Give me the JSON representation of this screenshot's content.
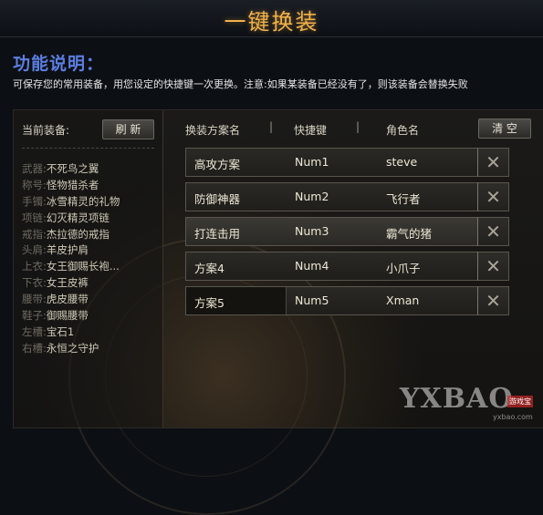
{
  "title": "一键换装",
  "description": {
    "heading": "功能说明：",
    "text": "可保存您的常用装备，用您设定的快捷键一次更换。注意:如果某装备已经没有了，则该装备会替换失败"
  },
  "current_equipment": {
    "label": "当前装备:",
    "refresh_label": "刷 新",
    "items": [
      {
        "slot": "武器:",
        "name": "不死鸟之翼"
      },
      {
        "slot": "称号:",
        "name": "怪物猎杀者"
      },
      {
        "slot": "手镯:",
        "name": "冰雪精灵的礼物"
      },
      {
        "slot": "项链:",
        "name": "幻灭精灵项链"
      },
      {
        "slot": "戒指:",
        "name": "杰拉德的戒指"
      },
      {
        "slot": "头肩:",
        "name": "羊皮护肩"
      },
      {
        "slot": "上衣:",
        "name": "女王御赐长袍..."
      },
      {
        "slot": "下衣:",
        "name": "女王皮裤"
      },
      {
        "slot": "腰带:",
        "name": "虎皮腰带"
      },
      {
        "slot": "鞋子:",
        "name": "御赐腰带"
      },
      {
        "slot": "左槽:",
        "name": "宝石1"
      },
      {
        "slot": "右槽:",
        "name": "永恒之守护"
      }
    ]
  },
  "table": {
    "headers": [
      "换装方案名",
      "快捷键",
      "角色名"
    ],
    "separator": "|",
    "clear_label": "清 空",
    "delete_glyph": "✕",
    "rows": [
      {
        "name": "高攻方案",
        "hotkey": "Num1",
        "role": "steve"
      },
      {
        "name": "防御神器",
        "hotkey": "Num2",
        "role": "飞行者"
      },
      {
        "name": "打连击用",
        "hotkey": "Num3",
        "role": "霸气的猪"
      },
      {
        "name": "方案4",
        "hotkey": "Num4",
        "role": "小爪子"
      },
      {
        "name": "方案5",
        "hotkey": "Num5",
        "role": "Xman"
      }
    ]
  },
  "watermark": {
    "logo": "YXBAO",
    "tag": "游戏宝",
    "url": "yxbao.com"
  }
}
